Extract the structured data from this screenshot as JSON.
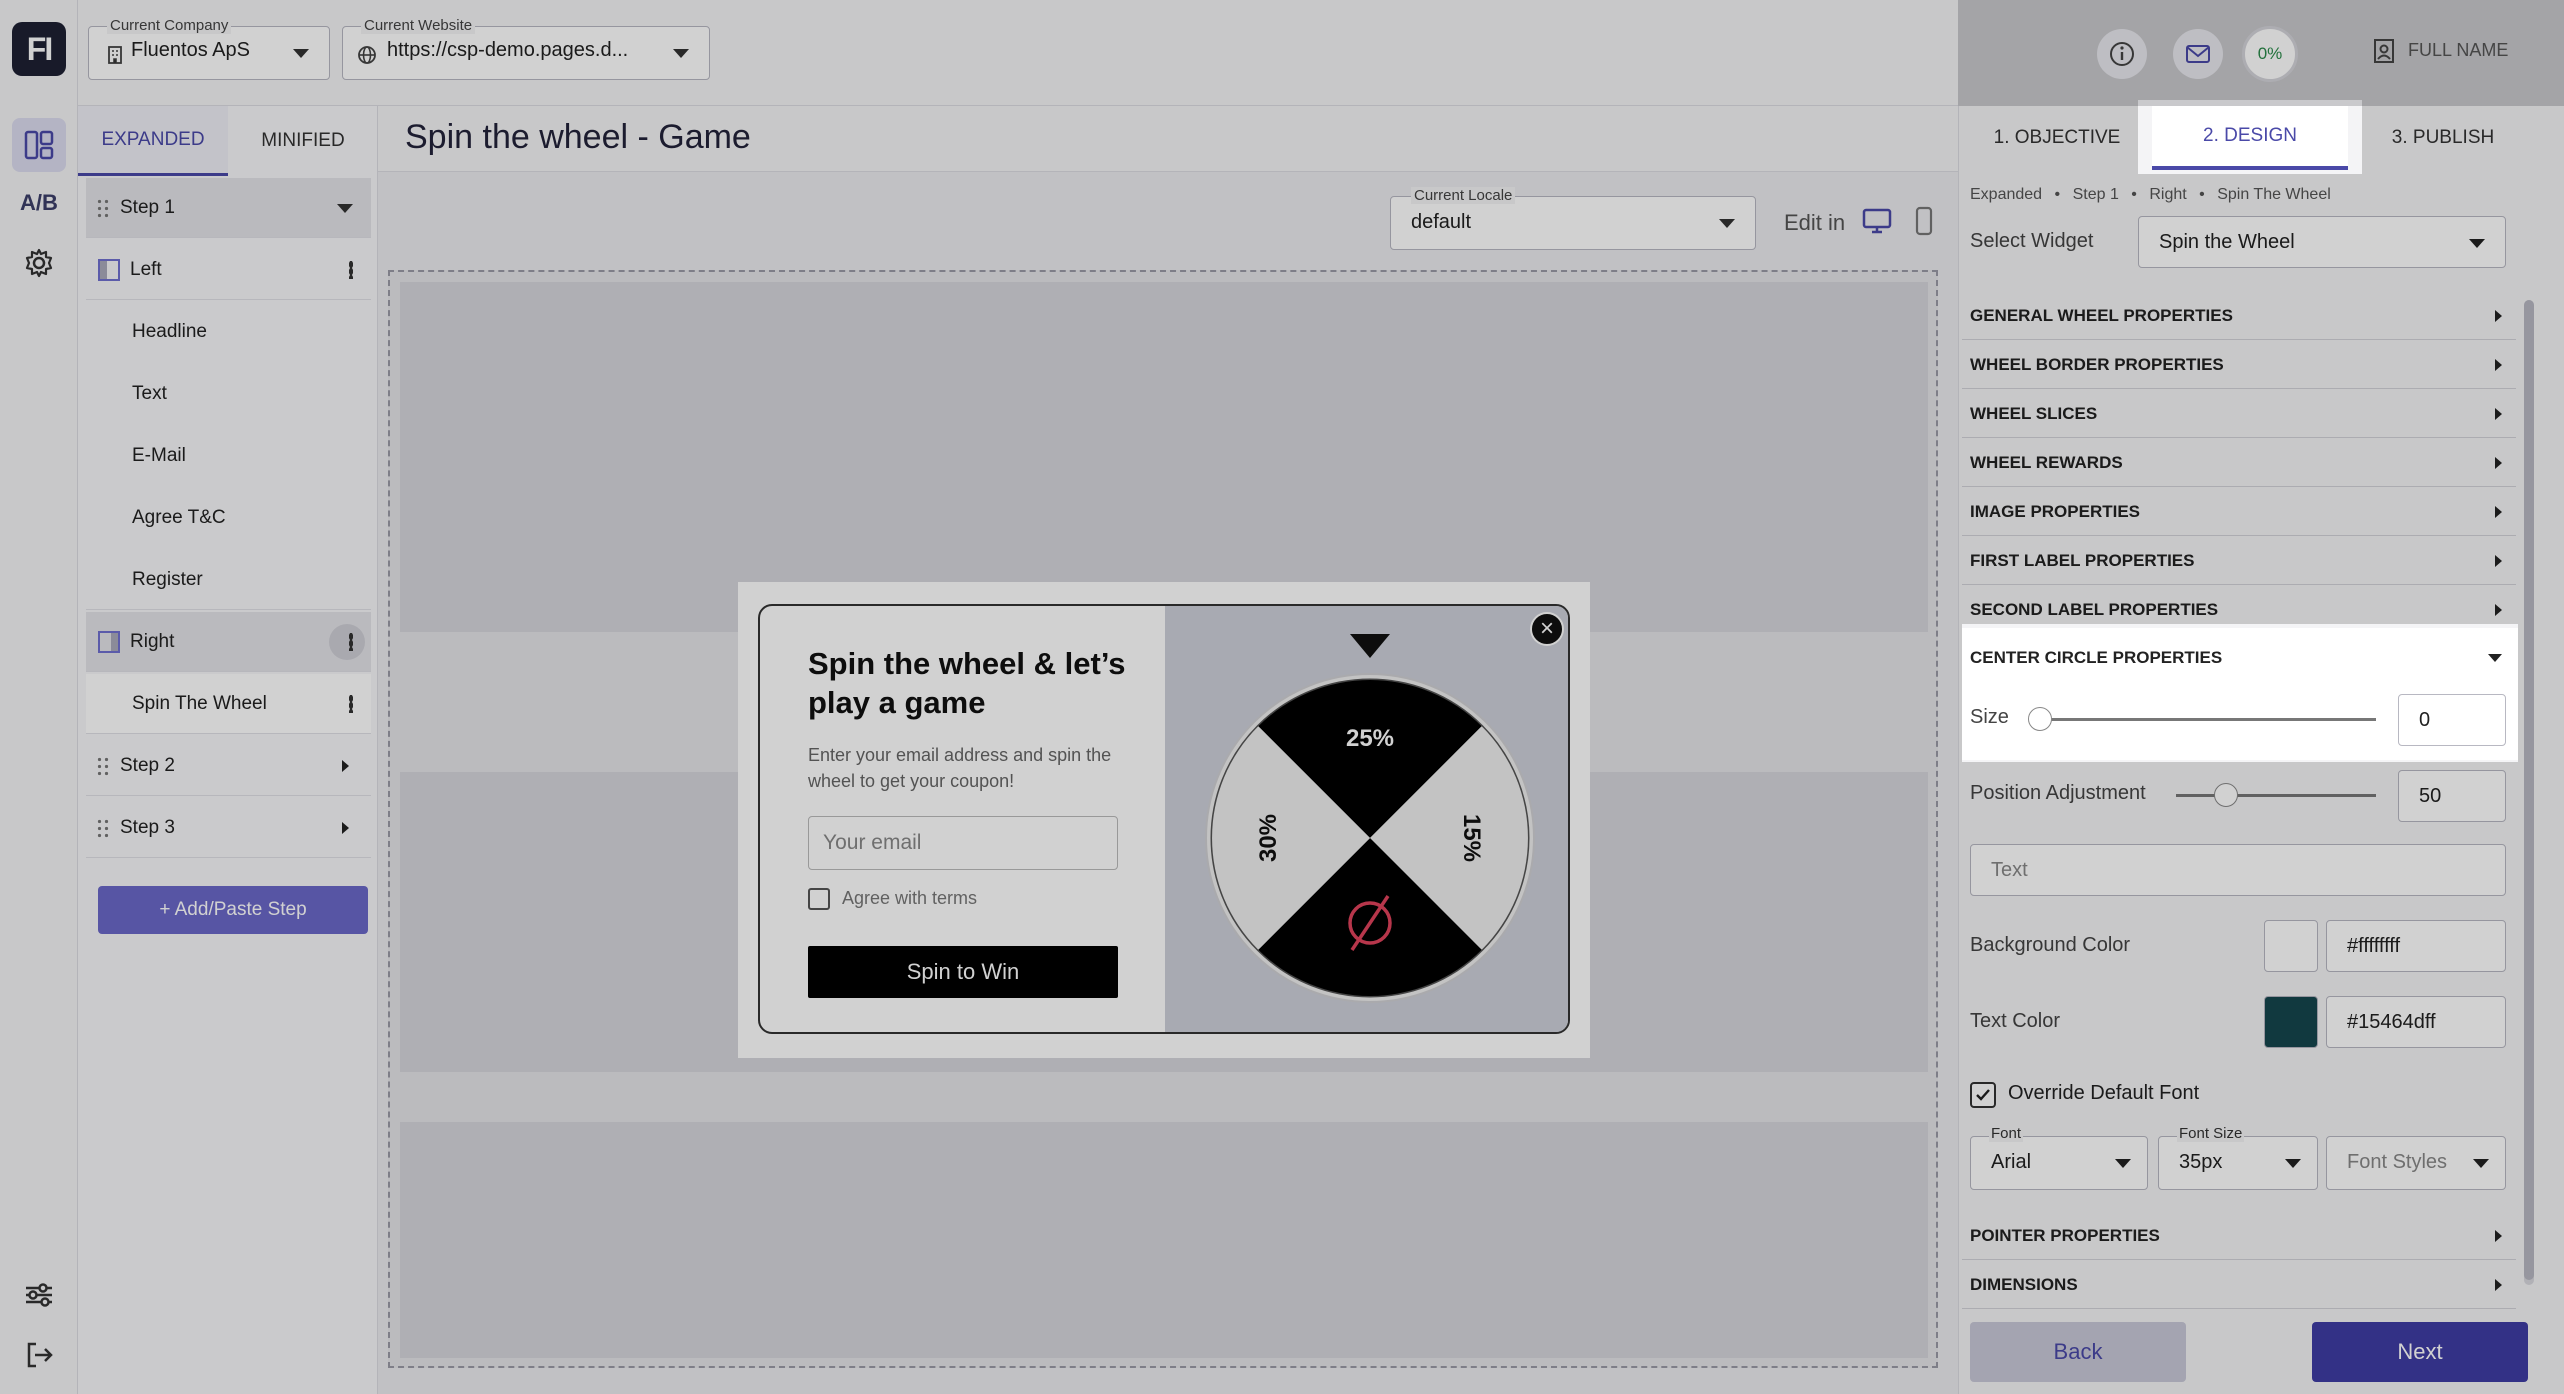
{
  "rail": {
    "logo": "FI",
    "ab_label": "A/B"
  },
  "topbar": {
    "company": {
      "caption": "Current Company",
      "value": "Fluentos ApS"
    },
    "website": {
      "caption": "Current Website",
      "value": "https://csp-demo.pages.d..."
    },
    "progress": "0%",
    "user": "FULL NAME"
  },
  "steps_panel": {
    "tabs": [
      {
        "label": "EXPANDED"
      },
      {
        "label": "MINIFIED"
      }
    ],
    "rows": [
      {
        "label": "Step 1"
      },
      {
        "label": "Left"
      },
      {
        "label": "Headline"
      },
      {
        "label": "Text"
      },
      {
        "label": "E-Mail"
      },
      {
        "label": "Agree T&C"
      },
      {
        "label": "Register"
      },
      {
        "label": "Right"
      },
      {
        "label": "Spin The Wheel"
      },
      {
        "label": "Step 2"
      },
      {
        "label": "Step 3"
      }
    ],
    "add_step": "+ Add/Paste Step"
  },
  "canvas": {
    "page_title": "Spin the wheel - Game",
    "locale": {
      "caption": "Current Locale",
      "value": "default"
    },
    "edit_in": "Edit in"
  },
  "popup": {
    "title": "Spin the wheel & let’s play a game",
    "description": "Enter your email address and spin the wheel to get your coupon!",
    "email_placeholder": "Your email",
    "agree": "Agree with terms",
    "button": "Spin to Win",
    "close": "×",
    "wheel": {
      "slices": [
        {
          "label": "25%",
          "color": "#000000"
        },
        {
          "label": "15%",
          "color": "#eeeeee"
        },
        {
          "label": "",
          "color": "#000000"
        },
        {
          "label": "30%",
          "color": "#eeeeee"
        }
      ],
      "no_win_icon": "ban-icon",
      "no_win_color": "#e0435c"
    }
  },
  "design_panel": {
    "tabs": [
      {
        "label": "1. OBJECTIVE"
      },
      {
        "label": "2. DESIGN"
      },
      {
        "label": "3. PUBLISH"
      }
    ],
    "crumbs": [
      "Expanded",
      "Step 1",
      "Right",
      "Spin The Wheel"
    ],
    "select_widget": {
      "label": "Select Widget",
      "value": "Spin the Wheel"
    },
    "sections": [
      {
        "label": "GENERAL WHEEL PROPERTIES"
      },
      {
        "label": "WHEEL BORDER PROPERTIES"
      },
      {
        "label": "WHEEL SLICES"
      },
      {
        "label": "WHEEL REWARDS"
      },
      {
        "label": "IMAGE PROPERTIES"
      },
      {
        "label": "FIRST LABEL PROPERTIES"
      },
      {
        "label": "SECOND LABEL PROPERTIES"
      },
      {
        "label": "CENTER CIRCLE PROPERTIES"
      }
    ],
    "center_circle": {
      "size_label": "Size",
      "size_value": "0",
      "size_fraction": 0,
      "position_label": "Position Adjustment",
      "position_value": "50",
      "position_fraction": 0.25,
      "text_placeholder": "Text",
      "bg_label": "Background Color",
      "bg_value": "#ffffffff",
      "bg_swatch": "#ffffff",
      "text_color_label": "Text Color",
      "text_color_value": "#15464dff",
      "text_color_swatch": "#15464d",
      "override_label": "Override Default Font",
      "override_checked": true,
      "font": {
        "caption": "Font",
        "value": "Arial"
      },
      "font_size": {
        "caption": "Font Size",
        "value": "35px"
      },
      "font_styles": {
        "placeholder": "Font Styles"
      }
    },
    "trailing_sections": [
      {
        "label": "POINTER PROPERTIES"
      },
      {
        "label": "DIMENSIONS"
      }
    ],
    "back": "Back",
    "next": "Next"
  },
  "colors": {
    "accent": "#4a49a8",
    "next_bg": "#3f3ca4",
    "add_step_bg": "#6b68c8"
  }
}
